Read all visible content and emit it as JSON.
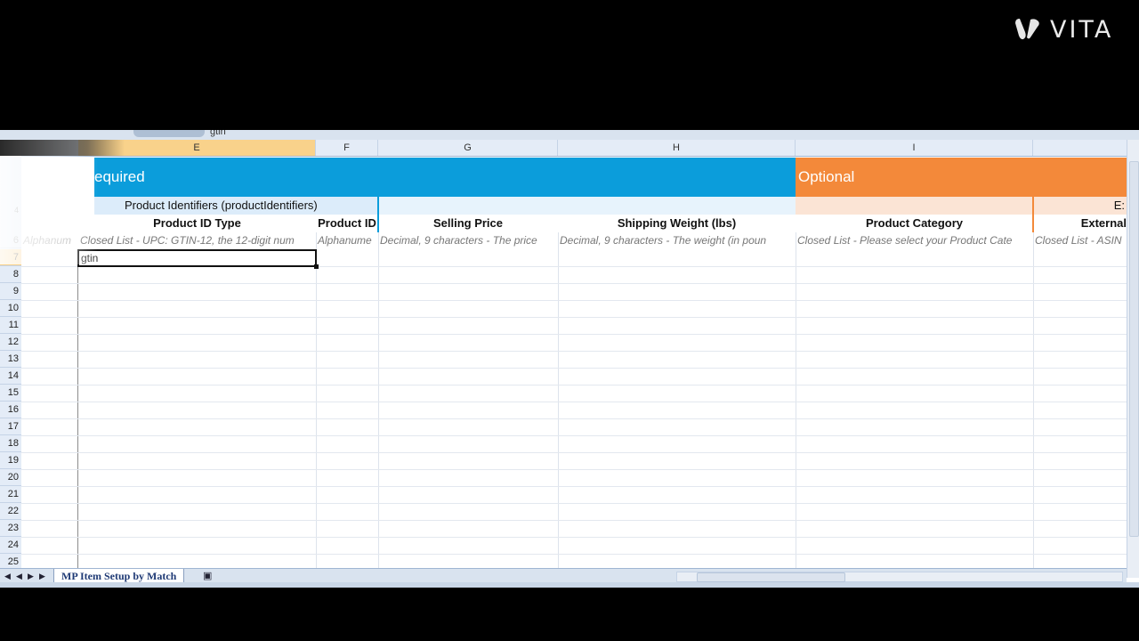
{
  "watermark": {
    "brand": "VITA"
  },
  "formula_bar": {
    "content": "gtin"
  },
  "columns": [
    {
      "letter": "E",
      "selected": true
    },
    {
      "letter": "F"
    },
    {
      "letter": "G"
    },
    {
      "letter": "H"
    },
    {
      "letter": "I"
    }
  ],
  "banners": {
    "required": "equired",
    "optional": "Optional"
  },
  "group": {
    "label": "Product Identifiers (productIdentifiers)",
    "right_fragment": "E:"
  },
  "headers": [
    "Product ID Type",
    "Product ID",
    "Selling Price",
    "Shipping Weight (lbs)",
    "Product Category",
    "External"
  ],
  "descriptions": [
    "Alphanum",
    "Closed List - UPC: GTIN-12, the 12-digit num",
    "Alphanume",
    "Decimal, 9 characters - The price",
    "Decimal, 9 characters - The weight (in poun",
    "Closed List - Please select your Product Cate",
    "Closed List - ASIN"
  ],
  "rows": [
    "4",
    "6",
    "7",
    "8",
    "9",
    "10",
    "11",
    "12",
    "13",
    "14",
    "15",
    "16",
    "17",
    "18",
    "19",
    "20",
    "21",
    "22",
    "23",
    "24",
    "25"
  ],
  "active_cell": {
    "row": "7",
    "value": "gtin"
  },
  "sheet_tabs": [
    "MP Item Setup by Match"
  ],
  "colors": {
    "required": "#0b9ddb",
    "optional": "#f3893a",
    "selected_header": "#f9d28b"
  }
}
